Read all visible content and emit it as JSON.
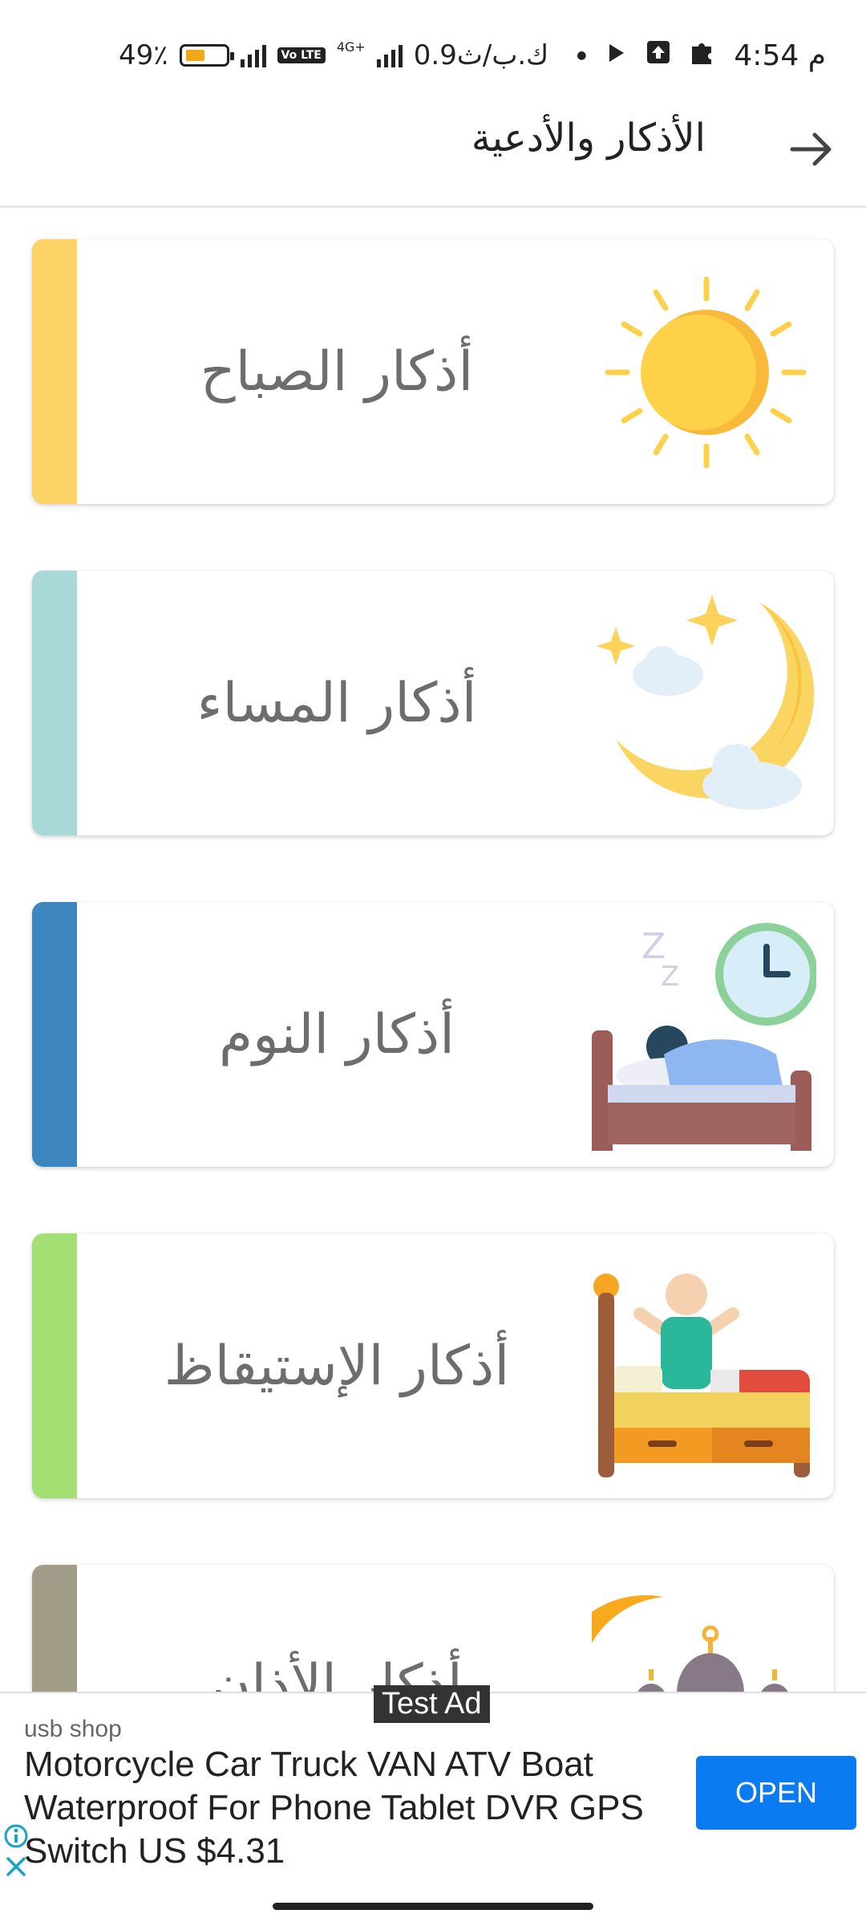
{
  "status_bar": {
    "time": "4:54",
    "ampm": "م",
    "speed": "0.9",
    "speed_unit": "ك.ب/ث",
    "network": "4G+",
    "volte": "Vo LTE",
    "battery_percent_label": "49٪",
    "battery_level": 0.49
  },
  "header": {
    "title": "الأذكار والأدعية",
    "back_icon": "arrow-right-icon"
  },
  "cards": [
    {
      "label": "أذكار الصباح",
      "stripe_color": "#fdd468",
      "icon": "sun-icon"
    },
    {
      "label": "أذكار المساء",
      "stripe_color": "#a8d8d8",
      "icon": "moon-icon"
    },
    {
      "label": "أذكار النوم",
      "stripe_color": "#3e86bf",
      "icon": "sleeping-bed-icon"
    },
    {
      "label": "أذكار الإستيقاظ",
      "stripe_color": "#a3e074",
      "icon": "waking-up-icon"
    },
    {
      "label": "أذكار الأذان",
      "stripe_color": "#a09c88",
      "icon": "mosque-icon"
    }
  ],
  "ad": {
    "badge": "Test Ad",
    "advertiser": "usb shop",
    "text": "Motorcycle Car Truck VAN ATV Boat Waterproof For Phone Tablet DVR GPS Switch US $4.31",
    "cta": "OPEN",
    "cta_color": "#0b7bf2"
  }
}
